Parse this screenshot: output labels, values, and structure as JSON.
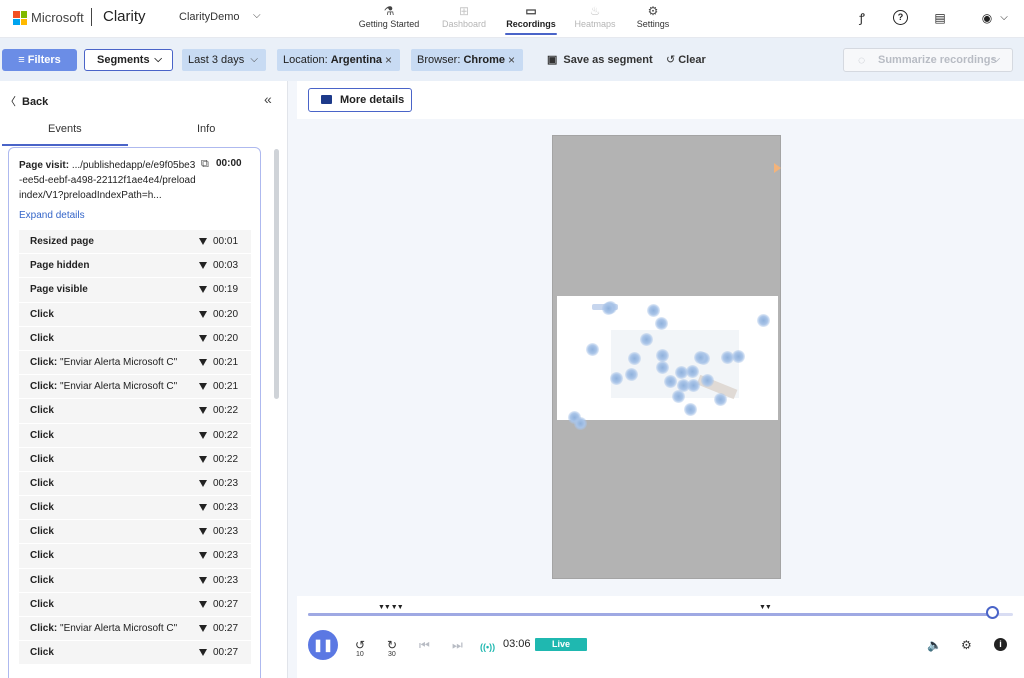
{
  "topbar": {
    "ms_text": "Microsoft",
    "brand": "Clarity",
    "project": "ClarityDemo",
    "project_chevron": "⌵",
    "tabs": [
      {
        "label": "Getting Started",
        "icon": "flask-icon",
        "glyph": "⚗"
      },
      {
        "label": "Dashboard",
        "icon": "grid-icon",
        "glyph": "⊞"
      },
      {
        "label": "Recordings",
        "icon": "video-icon",
        "glyph": "▭"
      },
      {
        "label": "Heatmaps",
        "icon": "flame-icon",
        "glyph": "♨"
      },
      {
        "label": "Settings",
        "icon": "gear-icon",
        "glyph": "⚙"
      }
    ],
    "right_icons": {
      "people": "ꝭ",
      "help": "?",
      "doc": "▤",
      "account": "◉",
      "account_chev": "⌵"
    }
  },
  "filterbar": {
    "filters_label": "Filters",
    "filters_glyph": "≡",
    "segments_label": "Segments",
    "segments_chev": "⌵",
    "chips": [
      {
        "text": "Last 3 days",
        "bold": "",
        "suffix": "⌵"
      },
      {
        "text": "Location: ",
        "bold": "Argentina",
        "suffix": "×"
      },
      {
        "text": "Browser: ",
        "bold": "Chrome",
        "suffix": "×"
      }
    ],
    "save_segment": "Save as segment",
    "save_glyph": "▣",
    "clear": "Clear",
    "clear_glyph": "↺",
    "summarize": "Summarize recordings",
    "summarize_glyph": "◌",
    "summarize_chev": "⌵"
  },
  "leftpanel": {
    "back": "Back",
    "back_glyph": "〈",
    "collapse_glyph": "«",
    "tabs": [
      "Events",
      "Info"
    ],
    "page_visit_label": "Page visit:",
    "page_visit_url": ".../publishedapp/e/e9f05be3-ee5d-eebf-a498-22112f1ae4e4/preloadindex/V1?preloadIndexPath=h...",
    "page_visit_time": "00:00",
    "external_glyph": "⧉",
    "expand": "Expand details",
    "events": [
      {
        "label": "Resized page",
        "detail": "",
        "time": "00:01"
      },
      {
        "label": "Page hidden",
        "detail": "",
        "time": "00:03"
      },
      {
        "label": "Page visible",
        "detail": "",
        "time": "00:19"
      },
      {
        "label": "Click",
        "detail": "",
        "time": "00:20"
      },
      {
        "label": "Click",
        "detail": "",
        "time": "00:20"
      },
      {
        "label": "Click:",
        "detail": " \"Enviar Alerta Microsoft C\"",
        "time": "00:21"
      },
      {
        "label": "Click:",
        "detail": " \"Enviar Alerta Microsoft C\"",
        "time": "00:21"
      },
      {
        "label": "Click",
        "detail": "",
        "time": "00:22"
      },
      {
        "label": "Click",
        "detail": "",
        "time": "00:22"
      },
      {
        "label": "Click",
        "detail": "",
        "time": "00:22"
      },
      {
        "label": "Click",
        "detail": "",
        "time": "00:23"
      },
      {
        "label": "Click",
        "detail": "",
        "time": "00:23"
      },
      {
        "label": "Click",
        "detail": "",
        "time": "00:23"
      },
      {
        "label": "Click",
        "detail": "",
        "time": "00:23"
      },
      {
        "label": "Click",
        "detail": "",
        "time": "00:23"
      },
      {
        "label": "Click",
        "detail": "",
        "time": "00:27"
      },
      {
        "label": "Click:",
        "detail": " \"Enviar Alerta Microsoft C\"",
        "time": "00:27"
      },
      {
        "label": "Click",
        "detail": "",
        "time": "00:27"
      }
    ]
  },
  "main": {
    "more_details": "More details"
  },
  "player": {
    "progress": 0.97,
    "pause_glyph": "❚❚",
    "rewind_label": "10",
    "forward_label": "30",
    "rewind_glyph": "↺",
    "forward_glyph": "↻",
    "prev_glyph": "⏮",
    "next_glyph": "⏭",
    "live_icon_glyph": "((•))",
    "time": "03:06",
    "live": "Live",
    "volume_glyph": "🔈",
    "settings_glyph": "⚙",
    "info_glyph": "i",
    "markers": [
      "▼▼ ▼▼",
      "▼▼"
    ]
  },
  "colors": {
    "accent": "#4a64c8",
    "filters_btn": "#6b8de6",
    "chip": "#c8dbf3",
    "live": "#1fb8b0",
    "play": "#5b78e3"
  }
}
